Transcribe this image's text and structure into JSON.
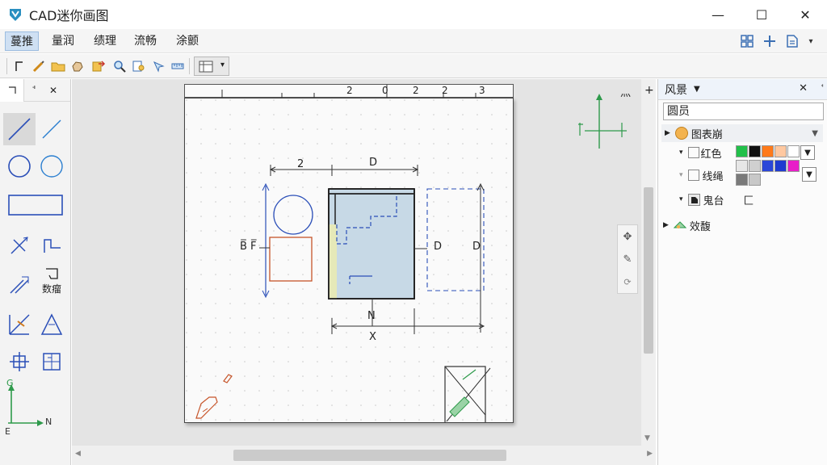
{
  "window": {
    "title": "CAD迷你画图",
    "minimize": "—",
    "maximize": "☐",
    "close": "✕"
  },
  "menu": {
    "items": [
      "蔓推",
      "量润",
      "绩理",
      "流畅",
      "涂颤"
    ],
    "active_index": 0
  },
  "left_panel": {
    "tab_pin": "ꜗ",
    "tab_close": "✕",
    "tool_label_text": "数瘤"
  },
  "ruler": {
    "labels": [
      "2",
      "0",
      "2",
      "2",
      "3"
    ]
  },
  "drawing": {
    "dim_top_left": "2",
    "dim_top_right": "D",
    "label_left": "B̅ F̅",
    "label_right_inner": "D",
    "label_right_outer": "D",
    "label_bottom_inner": "N",
    "label_bottom_outer": "X"
  },
  "canvas_side": {
    "top_label": "灬",
    "plus": "+"
  },
  "axes": {
    "y_label": "G",
    "x_label": "N",
    "origin_label": "E"
  },
  "right_panel": {
    "header": "风景",
    "header_close": "✕",
    "search_value": "圆员",
    "layer_group": "图表崩",
    "row_color_label": "红色",
    "row_line_label": "线绳",
    "row_third_label": "鬼台",
    "row_third_value": "匚",
    "section_other": "效馥"
  },
  "colors": {
    "accent_blue": "#3b6fb3",
    "menu_active": "#cfe0f3",
    "fill_blue": "#c7d9e6",
    "fill_yellow": "#e6e9b8",
    "dim_blue": "#2b4fb8",
    "orange": "#c7552a",
    "green": "#2e9a4b",
    "swatches_row1": [
      "#22c04a",
      "#111111",
      "#ff7a1a",
      "#ffc8a0",
      "#ffffff"
    ],
    "swatches_row2": [
      "#e6e6e6",
      "#d0d0d0",
      "#2a46d8",
      "#1f3bd0",
      "#e81ec8"
    ],
    "swatches_row3": [
      "#7a7a7a",
      "#c8c8c8"
    ]
  }
}
